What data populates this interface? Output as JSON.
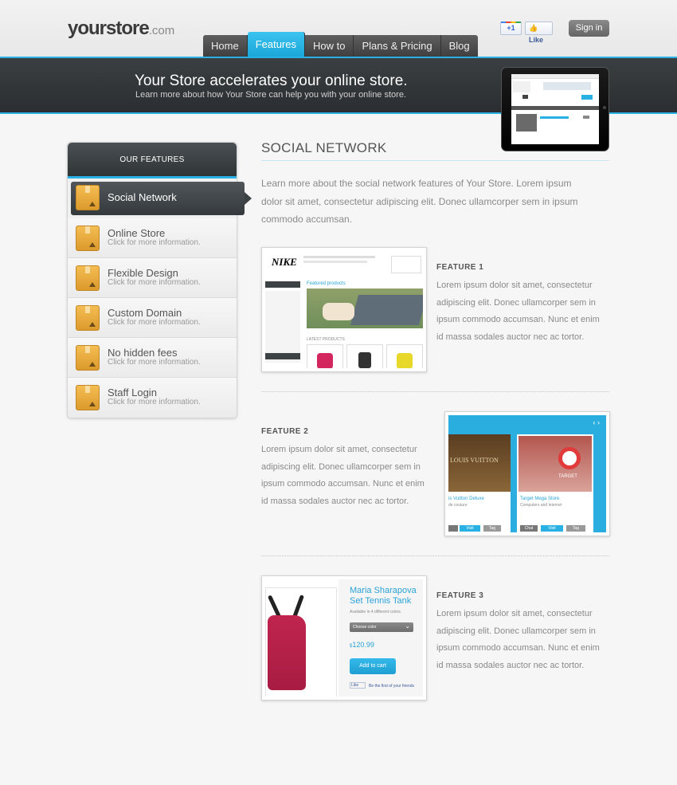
{
  "header": {
    "logo_main": "yourstore",
    "logo_tld": ".com",
    "nav": [
      "Home",
      "Features",
      "How to",
      "Plans & Pricing",
      "Blog"
    ],
    "active_nav": "Features",
    "gplus_label": "+1",
    "fb_label": "Like",
    "signin_label": "Sign in"
  },
  "hero": {
    "title": "Your Store accelerates your online store.",
    "subtitle": "Learn more about how Your Store can help you with your online store."
  },
  "sidebar": {
    "heading": "OUR FEATURES",
    "items": [
      {
        "label": "Social Network",
        "sub": ""
      },
      {
        "label": "Online Store",
        "sub": "Click for more information."
      },
      {
        "label": "Flexible Design",
        "sub": "Click for more information."
      },
      {
        "label": "Custom Domain",
        "sub": "Click for more information."
      },
      {
        "label": "No hidden fees",
        "sub": "Click for more information."
      },
      {
        "label": "Staff Login",
        "sub": "Click for more information."
      }
    ]
  },
  "main": {
    "title": "SOCIAL NETWORK",
    "intro": "Learn more about the social network features of Your Store. Lorem ipsum dolor sit amet, consectetur adipiscing elit. Donec ullamcorper sem in ipsum commodo accumsan.",
    "features": [
      {
        "label": "FEATURE 1",
        "text": "Lorem ipsum dolor sit amet, consectetur adipiscing elit. Donec ullamcorper sem in ipsum commodo accumsan. Nunc et enim id massa sodales auctor nec ac tortor."
      },
      {
        "label": "FEATURE 2",
        "text": "Lorem ipsum dolor sit amet, consectetur adipiscing elit. Donec ullamcorper sem in ipsum commodo accumsan. Nunc et enim id massa sodales auctor nec ac tortor."
      },
      {
        "label": "FEATURE 3",
        "text": "Lorem ipsum dolor sit amet, consectetur adipiscing elit. Donec ullamcorper sem in ipsum commodo accumsan. Nunc et enim id massa sodales auctor nec ac tortor."
      }
    ]
  },
  "shot1": {
    "brand": "NIKE",
    "featured": "Featured products",
    "latest": "LATEST PRODUCTS"
  },
  "shot2": {
    "card1_title": "is Vuitton Deluxe",
    "card1_sub": "de couture",
    "card1_sign": "LOUIS VUITTON",
    "card2_title": "Target Mega Store",
    "card2_sub": "Computers and internet",
    "card2_sign": "TARGET",
    "chat": "Chat",
    "visit": "Visit",
    "tag": "Tag",
    "arrows": "‹ ›"
  },
  "shot3": {
    "product_title_1": "Maria Sharapova",
    "product_title_2": "Set Tennis Tank",
    "availability": "Available in 4 different colors.",
    "select_placeholder": "Choose color",
    "price": "120.99",
    "currency": "$",
    "cta": "Add to cart",
    "like": "Like",
    "first_friend": "Be the first of your friends"
  },
  "colors": {
    "accent": "#29b1e3",
    "dark": "#3a3f42",
    "box_orange": "#e8a93c"
  }
}
